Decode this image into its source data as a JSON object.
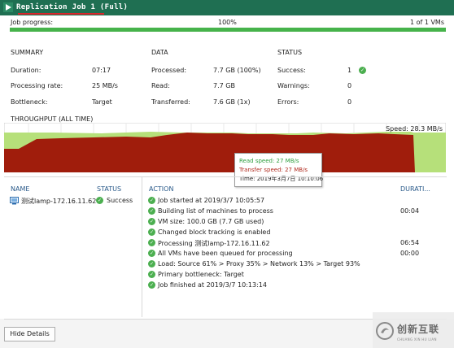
{
  "window": {
    "title": "Replication Job 1 (Full)"
  },
  "progress": {
    "label": "Job progress:",
    "percent_text": "100%",
    "percent": 100,
    "vms_text": "1 of 1 VMs"
  },
  "summary": {
    "heading": "SUMMARY",
    "duration_label": "Duration:",
    "duration_value": "07:17",
    "rate_label": "Processing rate:",
    "rate_value": "25 MB/s",
    "bottleneck_label": "Bottleneck:",
    "bottleneck_value": "Target"
  },
  "data": {
    "heading": "DATA",
    "processed_label": "Processed:",
    "processed_value": "7.7 GB (100%)",
    "read_label": "Read:",
    "read_value": "7.7 GB",
    "transferred_label": "Transferred:",
    "transferred_value": "7.6 GB (1x)"
  },
  "status": {
    "heading": "STATUS",
    "success_label": "Success:",
    "success_value": "1",
    "warnings_label": "Warnings:",
    "warnings_value": "0",
    "errors_label": "Errors:",
    "errors_value": "0"
  },
  "throughput": {
    "heading": "THROUGHPUT (ALL TIME)",
    "speed_label": "Speed: 28.3 MB/s",
    "tooltip": {
      "read": "Read speed: 27 MB/s",
      "transfer": "Transfer speed: 27 MB/s",
      "time": "Time: 2019年3月7日 10:10:06"
    }
  },
  "table": {
    "name_header": "NAME",
    "status_header": "STATUS",
    "action_header": "ACTION",
    "duration_header": "DURATI...",
    "vm": {
      "name": "测试lamp-172.16.11.62",
      "status": "Success"
    },
    "actions": [
      {
        "text": "Job started at 2019/3/7 10:05:57",
        "duration": ""
      },
      {
        "text": "Building list of machines to process",
        "duration": "00:04"
      },
      {
        "text": "VM size: 100.0 GB (7.7 GB used)",
        "duration": ""
      },
      {
        "text": "Changed block tracking is enabled",
        "duration": ""
      },
      {
        "text": "Processing 测试lamp-172.16.11.62",
        "duration": "06:54"
      },
      {
        "text": "All VMs have been queued for processing",
        "duration": "00:00"
      },
      {
        "text": "Load: Source 61% > Proxy 35% > Network 13% > Target 93%",
        "duration": ""
      },
      {
        "text": "Primary bottleneck: Target",
        "duration": ""
      },
      {
        "text": "Job finished at 2019/3/7 10:13:14",
        "duration": ""
      }
    ]
  },
  "footer": {
    "hide_details": "Hide Details"
  },
  "watermark": {
    "text": "创新互联",
    "sub": "CHUANG XIN HU LIAN"
  },
  "colors": {
    "titlebar": "#1f6f52",
    "progress": "#46b34b",
    "read_area": "#b6e07a",
    "transfer_area": "#a01d0c",
    "success": "#4caf50"
  },
  "icons": {
    "app": "play-arrow-icon",
    "ok": "check-circle-icon",
    "vm": "vm-icon",
    "watermark": "logo-icon"
  }
}
